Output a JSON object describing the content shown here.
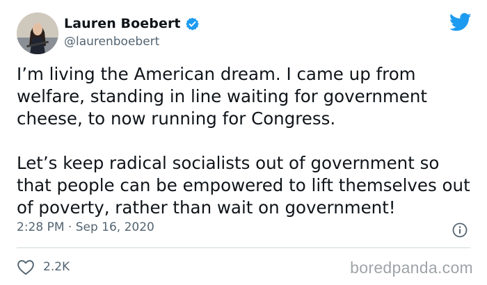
{
  "author": {
    "display_name": "Lauren Boebert",
    "handle": "@laurenboebert",
    "verified": true
  },
  "tweet": {
    "paragraphs": [
      "I’m living the American dream. I came up from welfare, standing in line waiting for government cheese, to now running for Congress.",
      "Let’s keep radical socialists out of government so that people can be empowered to lift themselves out of poverty, rather than wait on government!"
    ],
    "timestamp": "2:28 PM · Sep 16, 2020",
    "like_count": "2.2K"
  },
  "watermark": "boredpanda.com",
  "icons": {
    "brand": "twitter-bird-icon",
    "verified": "verified-badge-icon",
    "info": "info-icon",
    "like": "heart-icon"
  },
  "colors": {
    "twitter_blue": "#1d9bf0",
    "text": "#0f1419",
    "secondary_text": "#536471",
    "divider": "#cfd9de"
  }
}
